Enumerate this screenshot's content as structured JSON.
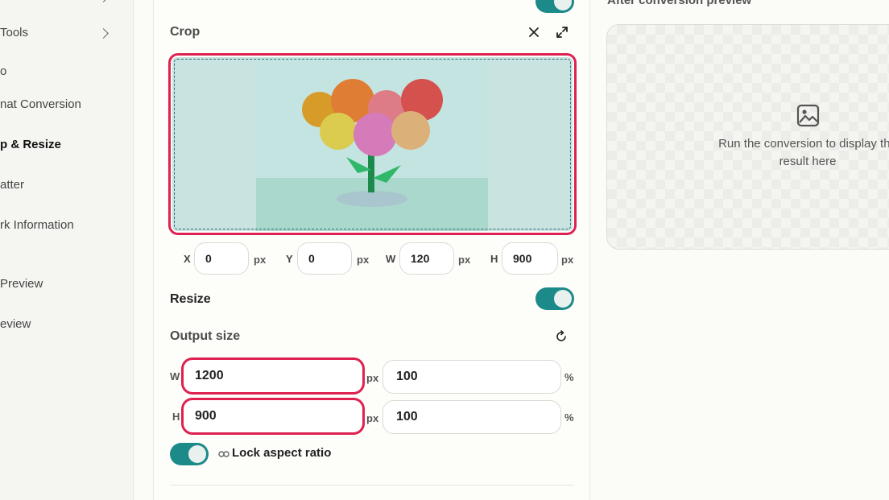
{
  "sidebar": {
    "items": [
      {
        "label": "Tools"
      },
      {
        "label": "o"
      },
      {
        "label": "nat Conversion"
      },
      {
        "label": "p & Resize"
      },
      {
        "label": "atter"
      },
      {
        "label": "rk Information"
      },
      {
        "label": "Preview"
      },
      {
        "label": "eview"
      }
    ]
  },
  "crop": {
    "title": "Crop",
    "x_label": "X",
    "x_value": "0",
    "y_label": "Y",
    "y_value": "0",
    "w_label": "W",
    "w_value": "120",
    "h_label": "H",
    "h_value": "900",
    "unit": "px"
  },
  "resize": {
    "title": "Resize",
    "enabled": true,
    "output_size_label": "Output size",
    "w_label": "W",
    "h_label": "H",
    "width_px": "1200",
    "height_px": "900",
    "width_pct": "100",
    "height_pct": "100",
    "px_unit": "px",
    "pct_unit": "%",
    "lock_label": "Lock aspect ratio",
    "lock_enabled": true
  },
  "preview": {
    "title": "After conversion preview",
    "message": "Run the conversion to display the result here"
  },
  "colors": {
    "accent": "#1d8a8a",
    "highlight": "#de2150"
  }
}
